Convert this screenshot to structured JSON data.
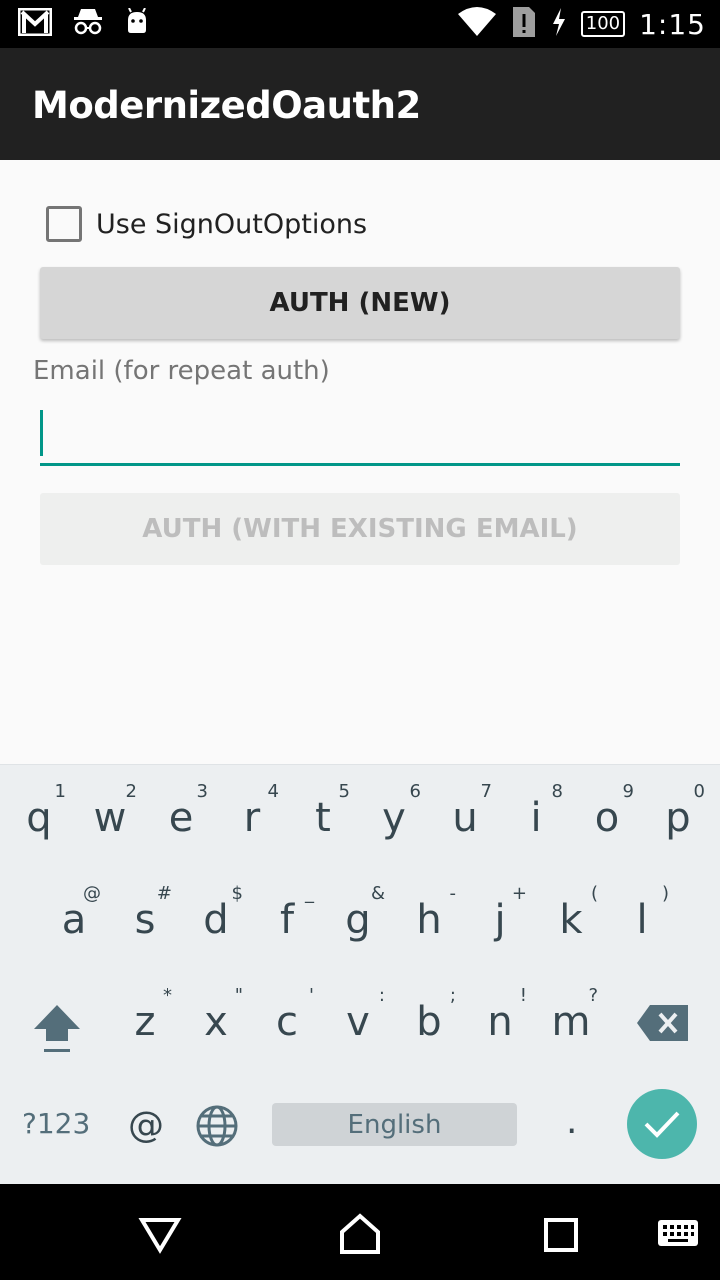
{
  "status_bar": {
    "time": "1:15",
    "battery": "100",
    "icons": [
      "gmail-icon",
      "incognito-icon",
      "android-icon",
      "wifi-icon",
      "sim-alert-icon",
      "charging-icon",
      "battery-icon"
    ]
  },
  "app_bar": {
    "title": "ModernizedOauth2"
  },
  "form": {
    "checkbox_label": "Use SignOutOptions",
    "checkbox_checked": false,
    "auth_new_label": "AUTH (NEW)",
    "email_label": "Email (for repeat auth)",
    "email_value": "",
    "auth_existing_label": "AUTH (WITH EXISTING EMAIL)"
  },
  "keyboard": {
    "row1": [
      {
        "key": "q",
        "hint": "1"
      },
      {
        "key": "w",
        "hint": "2"
      },
      {
        "key": "e",
        "hint": "3"
      },
      {
        "key": "r",
        "hint": "4"
      },
      {
        "key": "t",
        "hint": "5"
      },
      {
        "key": "y",
        "hint": "6"
      },
      {
        "key": "u",
        "hint": "7"
      },
      {
        "key": "i",
        "hint": "8"
      },
      {
        "key": "o",
        "hint": "9"
      },
      {
        "key": "p",
        "hint": "0"
      }
    ],
    "row2": [
      {
        "key": "a",
        "hint": "@"
      },
      {
        "key": "s",
        "hint": "#"
      },
      {
        "key": "d",
        "hint": "$"
      },
      {
        "key": "f",
        "hint": "_"
      },
      {
        "key": "g",
        "hint": "&"
      },
      {
        "key": "h",
        "hint": "-"
      },
      {
        "key": "j",
        "hint": "+"
      },
      {
        "key": "k",
        "hint": "("
      },
      {
        "key": "l",
        "hint": ")"
      }
    ],
    "row3": [
      {
        "key": "z",
        "hint": "*"
      },
      {
        "key": "x",
        "hint": "\""
      },
      {
        "key": "c",
        "hint": "'"
      },
      {
        "key": "v",
        "hint": ":"
      },
      {
        "key": "b",
        "hint": ";"
      },
      {
        "key": "n",
        "hint": "!"
      },
      {
        "key": "m",
        "hint": "?"
      }
    ],
    "symbols_label": "?123",
    "at_label": "@",
    "space_label": "English",
    "period_label": "."
  },
  "nav_bar": {
    "icons": [
      "back-icon",
      "home-icon",
      "recents-icon",
      "keyboard-switch-icon"
    ]
  },
  "colors": {
    "accent": "#009688",
    "enter_key": "#4db6ac",
    "app_bar": "#212121"
  }
}
